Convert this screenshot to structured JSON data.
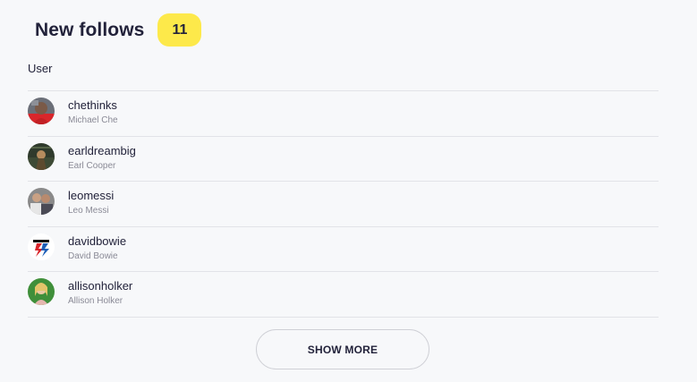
{
  "header": {
    "title": "New follows",
    "count": "11"
  },
  "table": {
    "column_user": "User"
  },
  "follows": [
    {
      "username": "chethinks",
      "name": "Michael Che",
      "avatar": "avatar-photo-red"
    },
    {
      "username": "earldreambig",
      "name": "Earl Cooper",
      "avatar": "avatar-photo-dark-green"
    },
    {
      "username": "leomessi",
      "name": "Leo Messi",
      "avatar": "avatar-photo-family"
    },
    {
      "username": "davidbowie",
      "name": "David Bowie",
      "avatar": "avatar-lightning-logo"
    },
    {
      "username": "allisonholker",
      "name": "Allison Holker",
      "avatar": "avatar-photo-green"
    }
  ],
  "actions": {
    "show_more": "SHOW MORE"
  },
  "colors": {
    "badge": "#fde94a",
    "background": "#f7f8fa",
    "divider": "#e2e3e8"
  }
}
